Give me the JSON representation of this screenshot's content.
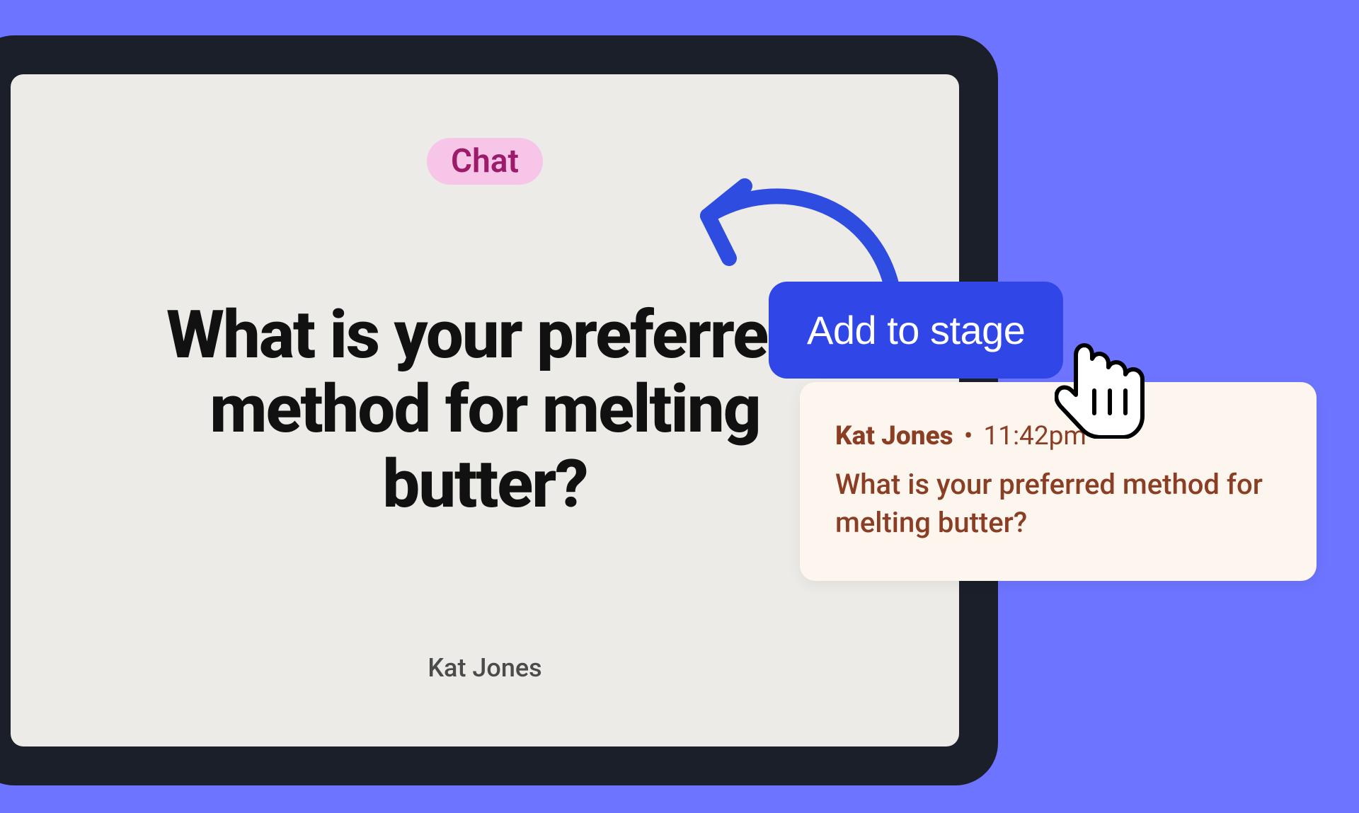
{
  "stage": {
    "badge_label": "Chat",
    "question": "What is your preferred method for melting butter?",
    "author": "Kat Jones"
  },
  "action": {
    "add_to_stage_label": "Add to stage"
  },
  "chat_card": {
    "name": "Kat Jones",
    "separator": "•",
    "time": "11:42pm",
    "message": "What is your preferred method for melting butter?"
  },
  "colors": {
    "background": "#6d74ff",
    "monitor": "#1b1f2a",
    "screen": "#ecebe8",
    "badge_bg": "#f7c5e8",
    "badge_fg": "#9c1c6a",
    "button_bg": "#3146e6",
    "button_fg": "#ffffff",
    "card_bg": "#fdf6ef",
    "card_fg": "#8a3e24",
    "arrow": "#2f4ce0"
  }
}
